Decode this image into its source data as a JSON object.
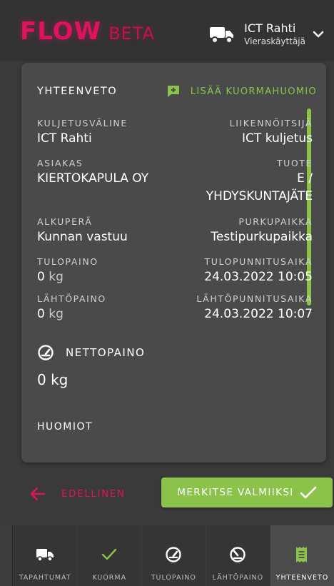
{
  "app": {
    "logo": "FLOW",
    "logo_badge": "BETA",
    "accent_color": "#e0115f",
    "success_color": "#8bc34a"
  },
  "user": {
    "name": "ICT Rahti",
    "role": "Vieraskäyttäjä",
    "icon": "truck-icon"
  },
  "summary": {
    "title": "YHTEENVETO",
    "add_note_label": "LISÄÄ KUORMAHUOMIO",
    "rows": [
      {
        "left_label": "KULJETUSVÄLINE",
        "left_value": "ICT Rahti",
        "right_label": "LIIKENNÖITSIJÄ",
        "right_value": "ICT kuljetus"
      },
      {
        "left_label": "ASIAKAS",
        "left_value": "KIERTOKAPULA OY",
        "right_label": "TUOTE",
        "right_value_1": "E /",
        "right_value_2": "YHDYSKUNTAJÄTE"
      },
      {
        "left_label": "ALKUPERÄ",
        "left_value": "Kunnan vastuu",
        "right_label": "PURKUPAIKKA",
        "right_value": "Testipurkupaikka"
      },
      {
        "left_label": "TULOPAINO",
        "left_value": "0",
        "left_unit": "kg",
        "right_label": "TULOPUNNITUSAIKA",
        "right_value": "24.03.2022 10:05"
      },
      {
        "left_label": "LÄHTÖPAINO",
        "left_value": "0",
        "left_unit": "kg",
        "right_label": "LÄHTÖPUNNITUSAIKA",
        "right_value": "24.03.2022 10:07"
      }
    ],
    "net_label": "NETTOPAINO",
    "net_value": "0 kg",
    "notes_title": "HUOMIOT"
  },
  "actions": {
    "previous": "EDELLINEN",
    "mark_done": "MERKITSE VALMIIKSI"
  },
  "tabs": [
    {
      "label": "TAPAHTUMAT",
      "icon": "truck-icon",
      "active": false
    },
    {
      "label": "KUORMA",
      "icon": "check-icon",
      "active": false
    },
    {
      "label": "TULOPAINO",
      "icon": "gauge-icon",
      "active": false
    },
    {
      "label": "LÄHTÖPAINO",
      "icon": "gauge-icon",
      "active": false
    },
    {
      "label": "YHTEENVETO",
      "icon": "receipt-icon",
      "active": true
    }
  ]
}
